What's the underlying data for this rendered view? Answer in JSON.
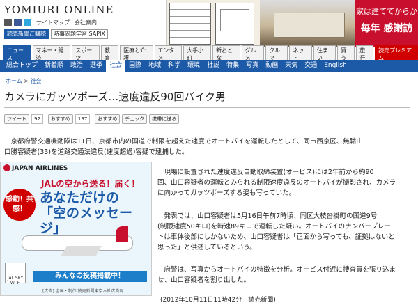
{
  "header": {
    "logo": "YOMIURI ONLINE",
    "sitemap": "サイトマップ",
    "company": "会社案内",
    "btn_member": "読売新聞ご購読",
    "btn_sapix": "時事問題学習 SAPIX"
  },
  "ad_top": {
    "line1": "家は建ててからか",
    "line2": "毎年 感謝訪"
  },
  "nav1": [
    "ニュース",
    "マネー・経済",
    "スポーツ",
    "教育",
    "医療と介護",
    "エンタメ",
    "大手小町",
    "新おとな",
    "グルメ",
    "クルマ",
    "ネット",
    "住まい",
    "買う",
    "旅行",
    "読売プレミアム"
  ],
  "nav2": [
    "総合トップ",
    "新着順",
    "政治",
    "選挙",
    "社会",
    "国際",
    "地域",
    "科学",
    "環境",
    "社説",
    "特集",
    "写真",
    "動画",
    "天気",
    "交通",
    "English"
  ],
  "nav2_active": "社会",
  "breadcrumb": {
    "home": "ホーム",
    "sep": " > ",
    "current": "社会"
  },
  "article": {
    "title": "カメラにガッツポーズ…速度違反90回バイク男",
    "tweet_label": "ツイート",
    "tweet_count": "92",
    "like_label": "おすすめ",
    "like_count": "137",
    "mixi_label": "おすすめ",
    "check_label": "チェック",
    "mobile_label": "携帯に送る",
    "p1a": "　京都府警交通機動隊は11日、京都市内の国道で制限を超えた速度でオートバイを運転したとして、同市西京区、無職山",
    "p1b": "口勝容疑者(33)を道路交通法違反(速度超過)容疑で逮捕した。",
    "p2a": "　現場に設置された速度違反自動取締装置(オービス)には2年前から約90",
    "p2b": "回、山口容疑者の運転とみられる制限速度違反のオートバイが撮影され、カメラ",
    "p2c": "に向かってガッツポーズする姿も写っていた。",
    "p3a": "　発表では、山口容疑者は5月16日午前7時頃、同区大枝沓掛町の国道9号",
    "p3b": "(制限速度50キロ)を時速89キロで運転した疑い。オートバイのナンバープレー",
    "p3c": "トは車体後部にしかないため、山口容疑者は「正面から写っても、証拠はないと",
    "p3d": "思った」と供述しているという。",
    "p4a": "　府警は、写真からオートバイの特徴を分析。オービス付近に捜査員を張り込ま",
    "p4b": "せ、山口容疑者を割り出した。",
    "date": "(2012年10月11日11時42分　読売新聞)"
  },
  "ad_jal": {
    "brand": "JAPAN AIRLINES",
    "sub": "JALの空から送る！届く！",
    "main1": "あなただけの",
    "main2": "「空のメッセージ」",
    "badge": "感動！共感！",
    "cta": "みんなの投稿掲載中！",
    "wifi": "JAL SKY Wi-Fi",
    "footer": "[広告] 企画・制作 読売新聞東京本社広告局"
  }
}
